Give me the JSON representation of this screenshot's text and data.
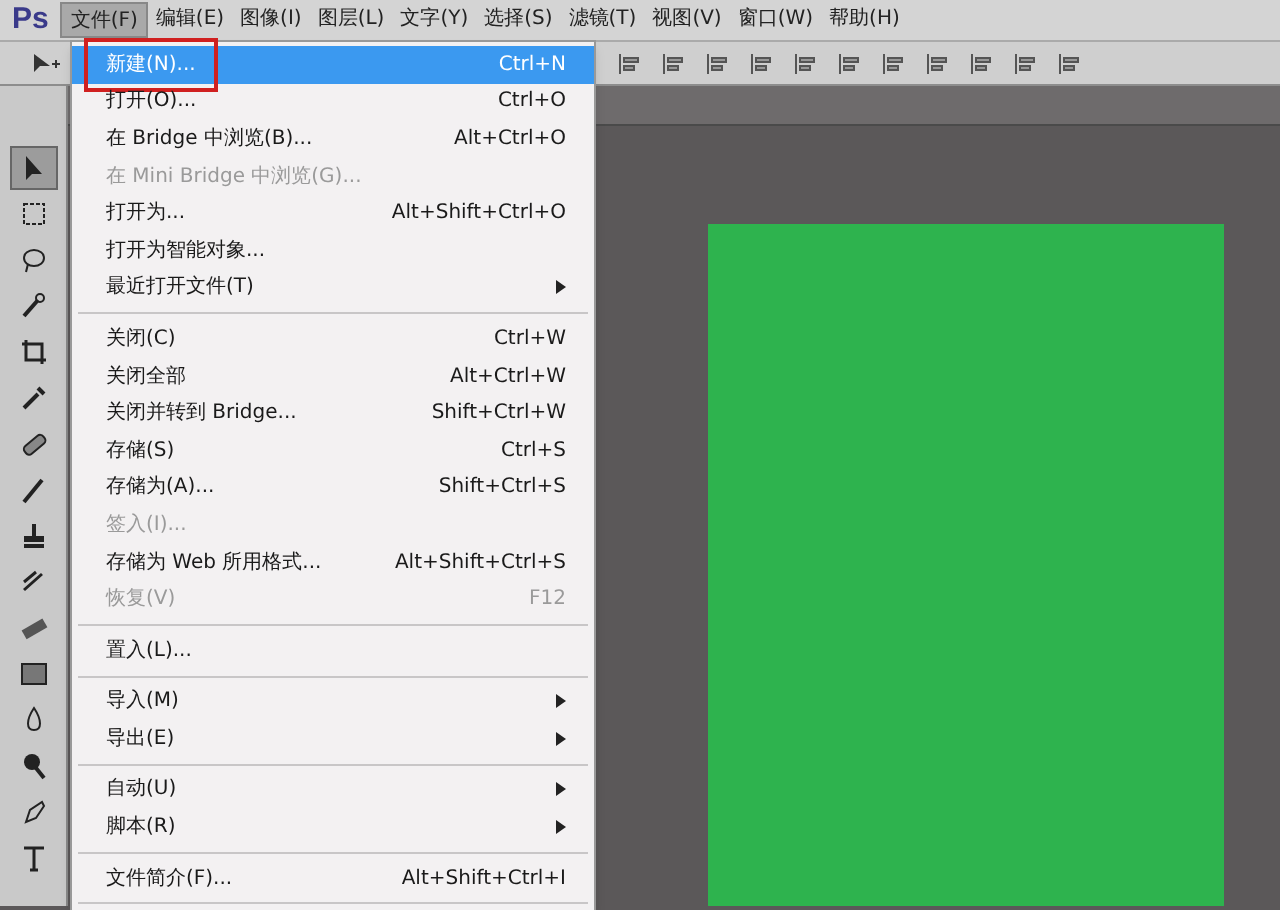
{
  "app": {
    "logo": "Ps"
  },
  "menu_bar": [
    {
      "label": "文件(F)",
      "selected": true
    },
    {
      "label": "编辑(E)",
      "selected": false
    },
    {
      "label": "图像(I)",
      "selected": false
    },
    {
      "label": "图层(L)",
      "selected": false
    },
    {
      "label": "文字(Y)",
      "selected": false
    },
    {
      "label": "选择(S)",
      "selected": false
    },
    {
      "label": "滤镜(T)",
      "selected": false
    },
    {
      "label": "视图(V)",
      "selected": false
    },
    {
      "label": "窗口(W)",
      "selected": false
    },
    {
      "label": "帮助(H)",
      "selected": false
    }
  ],
  "tools": [
    {
      "selected": true
    },
    {
      "selected": false
    },
    {
      "selected": false
    },
    {
      "selected": false
    },
    {
      "selected": false
    },
    {
      "selected": false
    },
    {
      "selected": false
    },
    {
      "selected": false
    },
    {
      "selected": false
    },
    {
      "selected": false
    },
    {
      "selected": false
    },
    {
      "selected": false
    },
    {
      "selected": false
    },
    {
      "selected": false
    },
    {
      "selected": false
    },
    {
      "selected": false
    }
  ],
  "file_menu": [
    {
      "kind": "item",
      "label": "新建(N)...",
      "shortcut": "Ctrl+N",
      "selected": true,
      "disabled": false,
      "submenu": false,
      "outlined": true
    },
    {
      "kind": "item",
      "label": "打开(O)...",
      "shortcut": "Ctrl+O",
      "selected": false,
      "disabled": false,
      "submenu": false,
      "outlined": false
    },
    {
      "kind": "item",
      "label": "在 Bridge 中浏览(B)...",
      "shortcut": "Alt+Ctrl+O",
      "selected": false,
      "disabled": false,
      "submenu": false,
      "outlined": false
    },
    {
      "kind": "item",
      "label": "在 Mini Bridge 中浏览(G)...",
      "selected": false,
      "disabled": true,
      "submenu": false,
      "outlined": false
    },
    {
      "kind": "item",
      "label": "打开为...",
      "shortcut": "Alt+Shift+Ctrl+O",
      "selected": false,
      "disabled": false,
      "submenu": false,
      "outlined": false
    },
    {
      "kind": "item",
      "label": "打开为智能对象...",
      "selected": false,
      "disabled": false,
      "submenu": false,
      "outlined": false
    },
    {
      "kind": "item",
      "label": "最近打开文件(T)",
      "selected": false,
      "disabled": false,
      "submenu": true,
      "outlined": false
    },
    {
      "kind": "separator"
    },
    {
      "kind": "item",
      "label": "关闭(C)",
      "shortcut": "Ctrl+W",
      "selected": false,
      "disabled": false,
      "submenu": false,
      "outlined": false
    },
    {
      "kind": "item",
      "label": "关闭全部",
      "shortcut": "Alt+Ctrl+W",
      "selected": false,
      "disabled": false,
      "submenu": false,
      "outlined": false
    },
    {
      "kind": "item",
      "label": "关闭并转到 Bridge...",
      "shortcut": "Shift+Ctrl+W",
      "selected": false,
      "disabled": false,
      "submenu": false,
      "outlined": false
    },
    {
      "kind": "item",
      "label": "存储(S)",
      "shortcut": "Ctrl+S",
      "selected": false,
      "disabled": false,
      "submenu": false,
      "outlined": false
    },
    {
      "kind": "item",
      "label": "存储为(A)...",
      "shortcut": "Shift+Ctrl+S",
      "selected": false,
      "disabled": false,
      "submenu": false,
      "outlined": false
    },
    {
      "kind": "item",
      "label": "签入(I)...",
      "selected": false,
      "disabled": true,
      "submenu": false,
      "outlined": false
    },
    {
      "kind": "item",
      "label": "存储为 Web 所用格式...",
      "shortcut": "Alt+Shift+Ctrl+S",
      "selected": false,
      "disabled": false,
      "submenu": false,
      "outlined": false
    },
    {
      "kind": "item",
      "label": "恢复(V)",
      "shortcut": "F12",
      "selected": false,
      "disabled": true,
      "submenu": false,
      "outlined": false
    },
    {
      "kind": "separator"
    },
    {
      "kind": "item",
      "label": "置入(L)...",
      "selected": false,
      "disabled": false,
      "submenu": false,
      "outlined": false
    },
    {
      "kind": "separator"
    },
    {
      "kind": "item",
      "label": "导入(M)",
      "selected": false,
      "disabled": false,
      "submenu": true,
      "outlined": false
    },
    {
      "kind": "item",
      "label": "导出(E)",
      "selected": false,
      "disabled": false,
      "submenu": true,
      "outlined": false
    },
    {
      "kind": "separator"
    },
    {
      "kind": "item",
      "label": "自动(U)",
      "selected": false,
      "disabled": false,
      "submenu": true,
      "outlined": false
    },
    {
      "kind": "item",
      "label": "脚本(R)",
      "selected": false,
      "disabled": false,
      "submenu": true,
      "outlined": false
    },
    {
      "kind": "separator"
    },
    {
      "kind": "item",
      "label": "文件简介(F)...",
      "shortcut": "Alt+Shift+Ctrl+I",
      "selected": false,
      "disabled": false,
      "submenu": false,
      "outlined": false
    },
    {
      "kind": "separator"
    }
  ]
}
